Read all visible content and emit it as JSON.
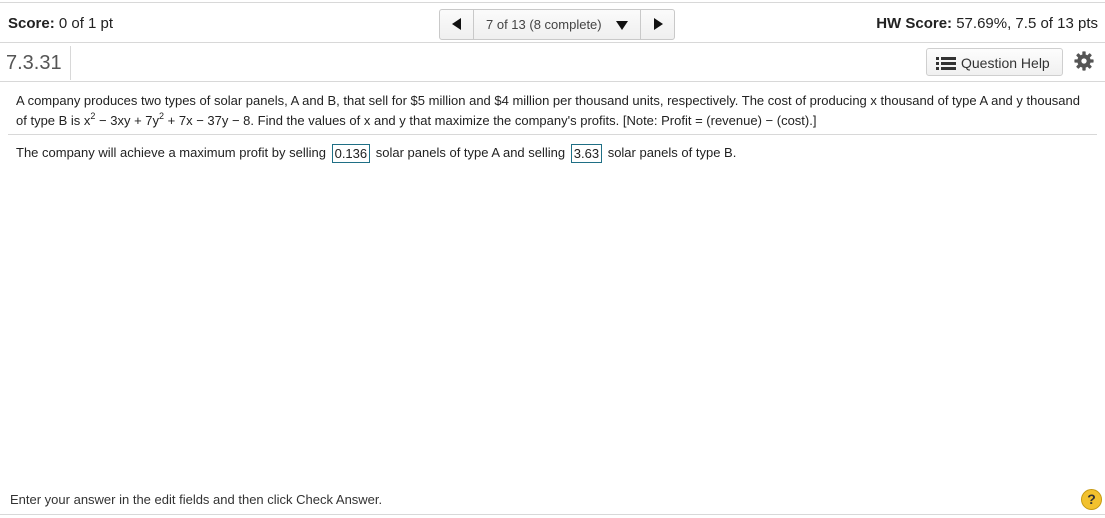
{
  "header": {
    "score_label": "Score:",
    "score_value": "0 of 1 pt",
    "nav": {
      "position_label": "7 of 13 (8 complete)"
    },
    "hw_score_label": "HW Score:",
    "hw_score_value": "57.69%, 7.5 of 13 pts"
  },
  "question": {
    "number": "7.3.31",
    "help_label": "Question Help",
    "icons": {
      "help_list": "list-icon",
      "settings": "gear-icon"
    }
  },
  "problem": {
    "intro": "A company produces two types of solar panels, A and B, that sell for $5 million and $4 million per thousand units, respectively. The cost of producing x thousand of type A and y thousand of type B is x",
    "sup1": "2",
    "mid": " − 3xy + 7y",
    "sup2": "2",
    "outro": " + 7x − 37y − 8. Find the values of x and y that maximize the company's profits. [Note: Profit = (revenue) − (cost).]"
  },
  "answer": {
    "prefix": "The company will achieve a maximum profit by selling",
    "box1_value": "0.136",
    "middle": "solar panels of type A and selling",
    "box2_value": "3.63",
    "suffix": "solar panels of type B."
  },
  "footer": {
    "instruction": "Enter your answer in the edit fields and then click Check Answer.",
    "help_glyph": "?"
  },
  "colors": {
    "answer_box_border": "#1f6f85",
    "help_circle": "#f2c12e"
  }
}
